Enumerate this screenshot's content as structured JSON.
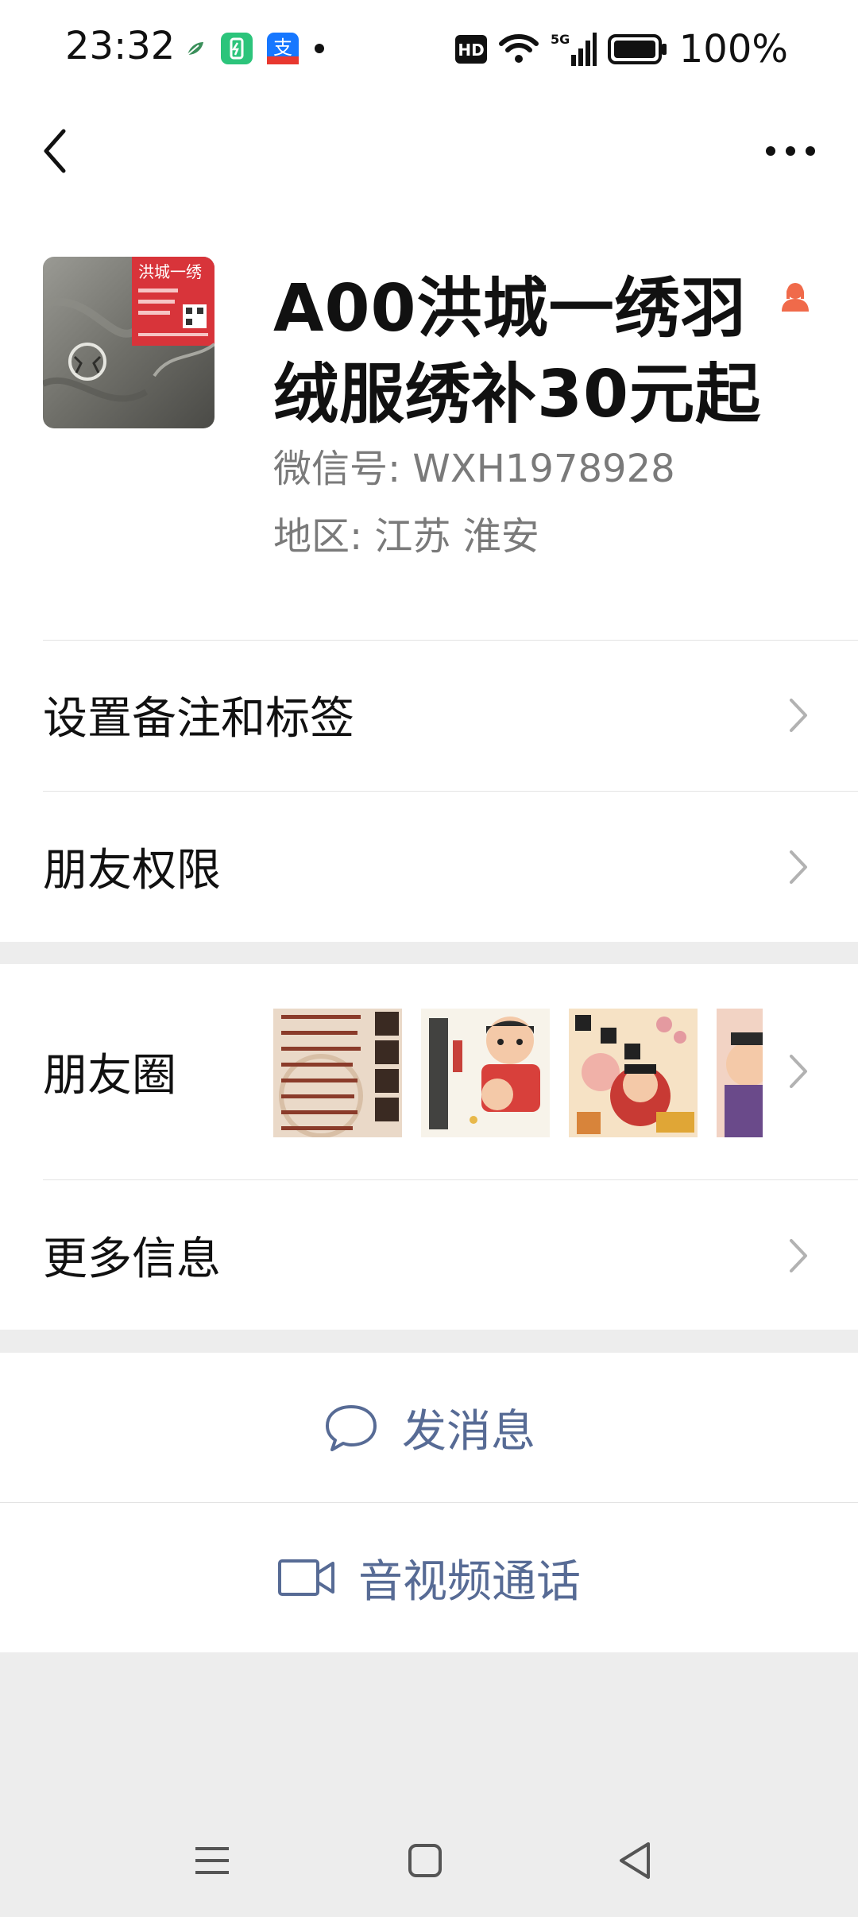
{
  "status_bar": {
    "time": "23:32",
    "battery_percent": "100%",
    "network": "5G",
    "hd": "HD",
    "notification_icons": [
      "leaf-icon",
      "battery-app-icon",
      "alipay-icon",
      "dot-icon"
    ]
  },
  "nav": {
    "back_icon": "chevron-left-icon",
    "more_icon": "ellipsis-icon"
  },
  "profile": {
    "name": "A00洪城一绣羽绒服绣补30元起",
    "wechat_id": "微信号:  WXH1978928",
    "region": "地区:  江苏  淮安",
    "gender_icon": "female-icon",
    "avatar_text": "洪城一绣"
  },
  "menu": {
    "remarks": "设置备注和标签",
    "permissions": "朋友权限",
    "moments": "朋友圈",
    "more_info": "更多信息"
  },
  "moments_thumbs": [
    {
      "alt": "龍年賀歲"
    },
    {
      "alt": "公主请发财"
    },
    {
      "alt": "该你发财啦"
    },
    {
      "alt": ""
    }
  ],
  "actions": {
    "message": "发消息",
    "call": "音视频通话"
  },
  "colors": {
    "link_blue": "#576b95",
    "background": "#ededed",
    "female_orange": "#f06a4a"
  }
}
